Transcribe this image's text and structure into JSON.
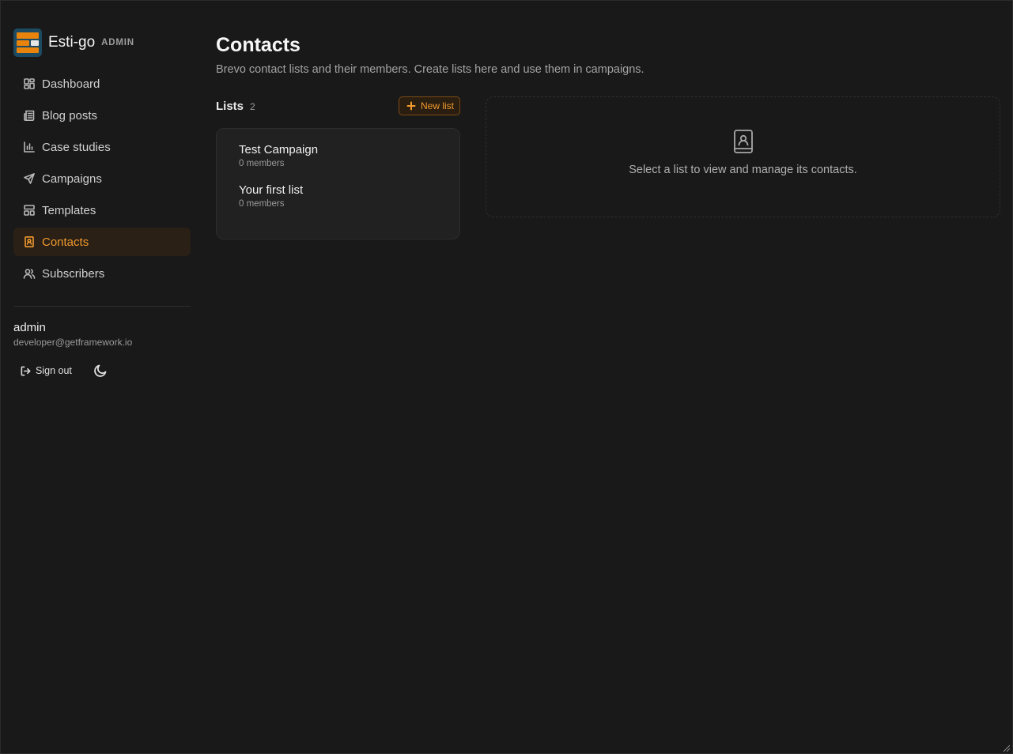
{
  "brand": {
    "name": "Esti-go",
    "tag": "ADMIN"
  },
  "sidebar": {
    "items": [
      {
        "label": "Dashboard",
        "icon": "dashboard-icon",
        "active": false
      },
      {
        "label": "Blog posts",
        "icon": "newspaper-icon",
        "active": false
      },
      {
        "label": "Case studies",
        "icon": "bar-chart-icon",
        "active": false
      },
      {
        "label": "Campaigns",
        "icon": "send-icon",
        "active": false
      },
      {
        "label": "Templates",
        "icon": "layout-template-icon",
        "active": false
      },
      {
        "label": "Contacts",
        "icon": "contact-book-icon",
        "active": true
      },
      {
        "label": "Subscribers",
        "icon": "users-icon",
        "active": false
      }
    ]
  },
  "user": {
    "name": "admin",
    "email": "developer@getframework.io",
    "signout_label": "Sign out",
    "theme_icon": "moon-icon"
  },
  "page": {
    "title": "Contacts",
    "subtitle": "Brevo contact lists and their members. Create lists here and use them in campaigns."
  },
  "lists": {
    "label": "Lists",
    "count": "2",
    "new_button_label": "New list",
    "items": [
      {
        "name": "Test Campaign",
        "members": "0 members"
      },
      {
        "name": "Your first list",
        "members": "0 members"
      }
    ]
  },
  "detail": {
    "empty_message": "Select a list to view and manage its contacts."
  },
  "colors": {
    "background": "#191919",
    "accent": "#f29a2e",
    "active_bg": "#2a2015",
    "card_bg": "#212121"
  }
}
